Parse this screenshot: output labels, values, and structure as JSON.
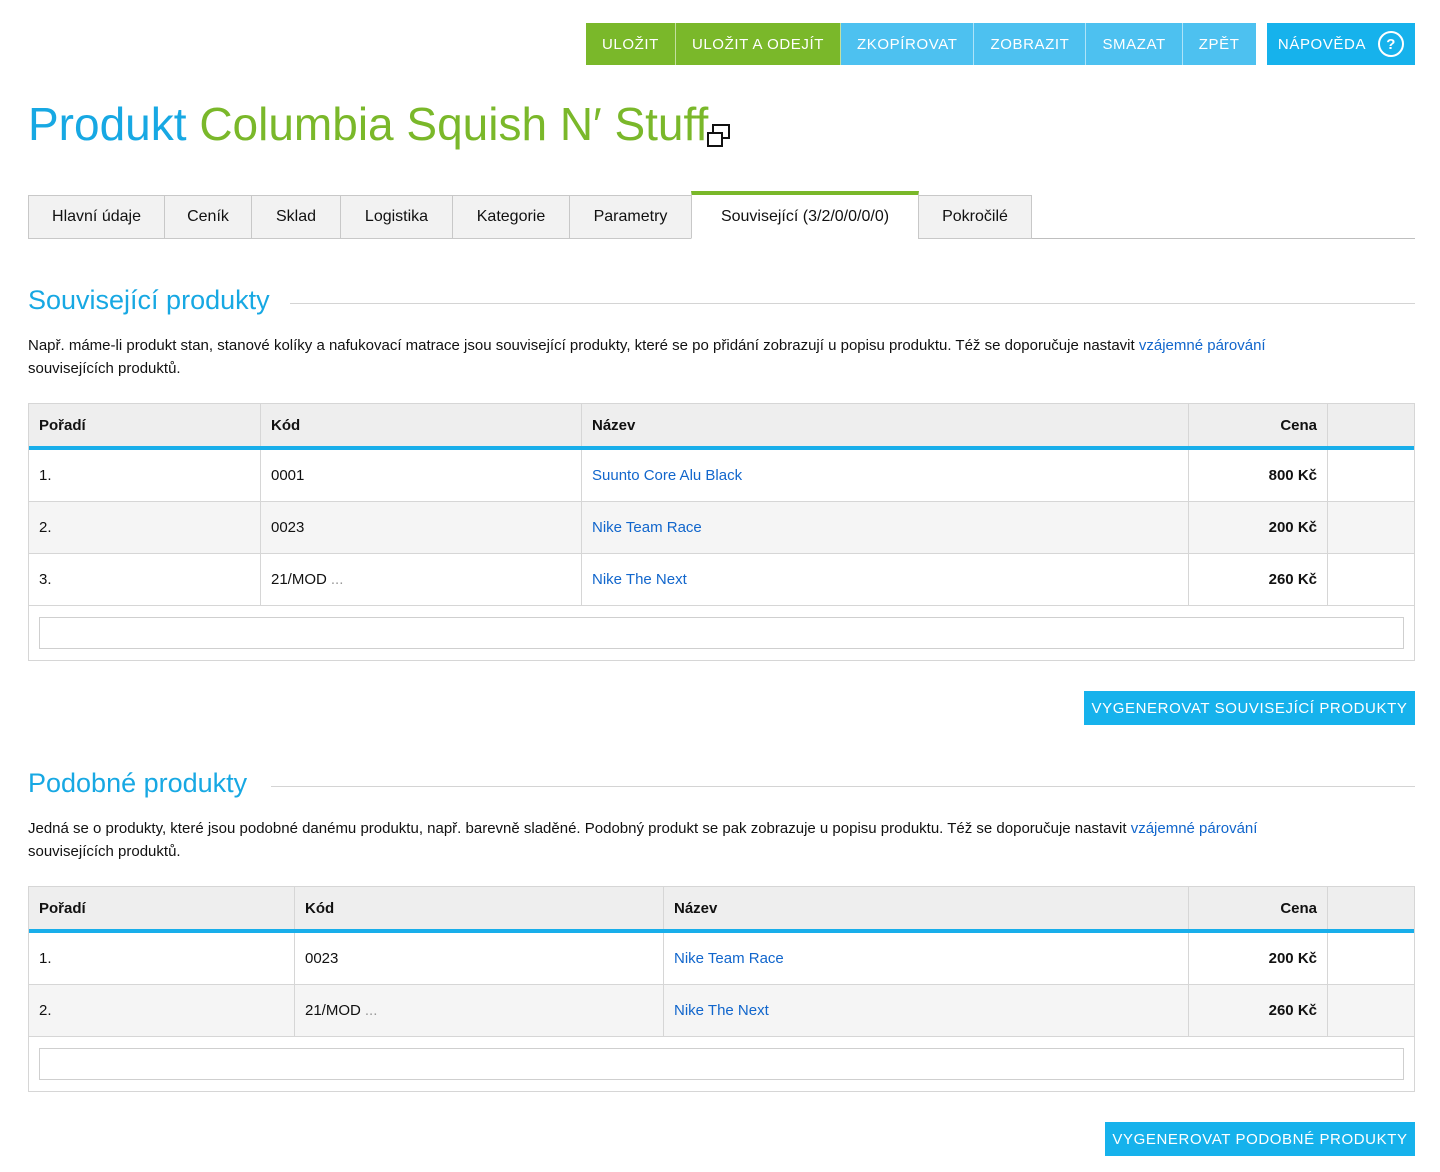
{
  "toolbar": {
    "save": "Uložit",
    "save_exit": "Uložit a odejít",
    "copy": "Zkopírovat",
    "show": "Zobrazit",
    "delete": "Smazat",
    "back": "Zpět",
    "help": "Nápověda"
  },
  "colors": {
    "accent_blue": "#17a8e3",
    "accent_green": "#7ab82a",
    "link": "#1166cc"
  },
  "title": {
    "prefix": "Produkt",
    "name": "Columbia Squish N′ Stuff",
    "open_icon": "open-in-new-window-icon"
  },
  "tabs": [
    "Hlavní údaje",
    "Ceník",
    "Sklad",
    "Logistika",
    "Kategorie",
    "Parametry",
    "Související (3/2/0/0/0/0)",
    "Pokročilé"
  ],
  "active_tab": "Související (3/2/0/0/0/0)",
  "related": {
    "title": "Související produkty",
    "desc_text": "Např. máme-li produkt stan, stanové kolíky a nafukovací matrace jsou související produkty, které se po přidání zobrazují u popisu produktu. Též se doporučuje nastavit",
    "desc_link": "vzájemné párování",
    "desc_tail": "souvisejících produktů.",
    "columns": [
      "Pořadí",
      "Kód",
      "Název",
      "Cena"
    ],
    "rows": [
      {
        "order": "1.",
        "code": "0001",
        "dots": "",
        "name": "Suunto Core Alu Black",
        "price": "800 Kč"
      },
      {
        "order": "2.",
        "code": "0023",
        "dots": "",
        "name": "Nike Team Race",
        "price": "200 Kč"
      },
      {
        "order": "3.",
        "code": "21/MOD",
        "dots": "...",
        "name": "Nike The Next",
        "price": "260 Kč"
      }
    ],
    "generate_button": "Vygenerovat související produkty"
  },
  "similar": {
    "title": "Podobné produkty",
    "desc_text": "Jedná se o produkty, které jsou podobné danému produktu, např. barevně sladěné. Podobný produkt se pak zobrazuje u popisu produktu. Též se doporučuje nastavit",
    "desc_link": "vzájemné párování",
    "desc_tail": "souvisejících produktů.",
    "columns": [
      "Pořadí",
      "Kód",
      "Název",
      "Cena"
    ],
    "rows": [
      {
        "order": "1.",
        "code": "0023",
        "dots": "",
        "name": "Nike Team Race",
        "price": "200 Kč"
      },
      {
        "order": "2.",
        "code": "21/MOD",
        "dots": "...",
        "name": "Nike The Next",
        "price": "260 Kč"
      }
    ],
    "generate_button": "Vygenerovat podobné produkty"
  }
}
